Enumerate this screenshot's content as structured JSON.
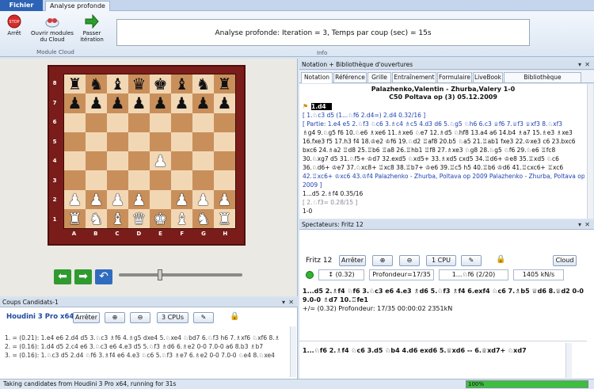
{
  "ribbon": {
    "tab_file": "Fichier",
    "tab_analysis": "Analyse profonde",
    "btn_stop": "Arrêt",
    "btn_open_cloud": "Ouvrir modules du Cloud",
    "btn_next_iter": "Passer itération",
    "group_cloud": "Module Cloud",
    "group_info": "Info",
    "info_text": "Analyse profonde: Iteration = 3, Temps par coup (sec) = 15s"
  },
  "board": {
    "ranks": [
      "8",
      "7",
      "6",
      "5",
      "4",
      "3",
      "2",
      "1"
    ],
    "files": [
      "A",
      "B",
      "C",
      "D",
      "E",
      "F",
      "G",
      "H"
    ],
    "position": [
      [
        "br",
        "bn",
        "bb",
        "bq",
        "bk",
        "bb",
        "bn",
        "br"
      ],
      [
        "bp",
        "bp",
        "bp",
        "bp",
        "bp",
        "bp",
        "bp",
        "bp"
      ],
      [
        "",
        "",
        "",
        "",
        "",
        "",
        "",
        ""
      ],
      [
        "",
        "",
        "",
        "",
        "",
        "",
        "",
        ""
      ],
      [
        "",
        "",
        "",
        "",
        "wp",
        "",
        "",
        ""
      ],
      [
        "",
        "",
        "",
        "",
        "",
        "",
        "",
        ""
      ],
      [
        "wp",
        "wp",
        "wp",
        "wp",
        "",
        "wp",
        "wp",
        "wp"
      ],
      [
        "wr",
        "wn",
        "wb",
        "wq",
        "wk",
        "wb",
        "wn",
        "wr"
      ]
    ]
  },
  "candidates": {
    "title": "Coups Candidats-1",
    "engine": "Houdini 3 Pro x64",
    "stop": "Arrêter",
    "cpus": "3 CPUs",
    "lines": [
      "1. = (0.21): 1.e4 e6 2.d4 d5 3.♘c3 ♗f6 4.♗g5 dxe4 5.♘xe4 ♘bd7 6.♘f3 h6 7.♗xf6 ♘xf6 8.♗",
      "2. = (0.16): 1.d4 d5 2.c4 e6 3.♘c3 e6 4.e3 d5 5.♘f3 ♗d6 6.♗e2 0-0 7.0-0 a6 8.b3 ♗b7",
      "3. = (0.16): 1.♘c3 d5 2.d4 ♘f6 3.♗f4 e6 4.e3 ♘c6 5.♘f3 ♗e7 6.♗e2 0-0 7.0-0 ♘e4 8.♘xe4"
    ]
  },
  "notation": {
    "title": "Notation + Bibliothèque d'ouvertures",
    "tabs": [
      "Notation",
      "Référence",
      "Grille",
      "Entraînement",
      "Formulaire",
      "LiveBook",
      "Bibliothèque d'ouvertures"
    ],
    "players": "Palazhenko,Valentin - Zhurba,Valery  1-0",
    "event": "C50 Poltava op (3) 05.12.2009",
    "lines": [
      "1.d4",
      "[ 1.♘c3  d5  (1...♘f6 2.d4=)  2.d4 0.32/16 ]",
      "[ Partie: 1.e4 e5 2.♘f3 ♘c6 3.♗c4 ♗c5 4.d3 d6 5.♘g5 ♘h6 6.c3 ♕f6 7.♕f3 ♕xf3 8.♘xf3",
      "♗g4 9.♘g5 f6 10.♘e6 ♗xe6 11.♗xe6 ♘e7 12.♗d5 ♘hf8 13.a4 a6 14.b4 ♗a7 15.♗e3 ♗xe3",
      "16.fxe3 f5 17.h3 f4 18.♔e2 ♔f6 19.♘d2 ♖af8 20.b5 ♘a5 21.♖ab1 fxe3 22.♔xe3 c6 23.bxc6",
      "bxc6 24.♗a2 ♖d8 25.♖b6 ♖a8 26.♖hb1 ♖f8 27.♗xe3 ♘g8 28.♘g5 ♘f6 29.♘e6 ♖fc8",
      "30.♘xg7 d5 31.♘f5+ ♔d7 32.exd5 ♘xd5+ 33.♗xd5 cxd5 34.♖d6+ ♔e8 35.♖xd5 ♘c6",
      "36.♘d6+ ♔e7 37.♘xc8+ ♖xc8 38.♖b7+ ♔e6 39.♖c5 h5 40.♖b6 ♔d6 41.♖cxc6+ ♖xc6",
      "42.♖xc6+ ♔xc6 43.♔f4 Palazhenko - Zhurba, Poltava op 2009 Palazhenko - Zhurba, Poltava op",
      "2009 ]",
      "1...d5  2.♗f4 0.35/16",
      "[ 2.♘f3= 0.28/15 ]",
      "1-0"
    ]
  },
  "spectators": {
    "title": "Spectateurs: Fritz 12",
    "engine": "Fritz 12",
    "stop": "Arrêter",
    "cpu": "1 CPU",
    "cloud": "Cloud",
    "eval": "(0.32)",
    "depth": "Profondeur=17/35",
    "move": "1...♘f6 (2/20)",
    "speed": "1405 kN/s",
    "line1": "1...d5 2.♗f4 ♘f6 3.♘c3 e6 4.e3 ♗d6 5.♘f3 ♗f4 6.exf4 ♘c6 7.♗b5 ♕d6 8.♕d2 0-0",
    "line2": "9.0-0 ♗d7 10.♖fe1",
    "line3": "+/=  (0.32)   Profondeur: 17/35   00:00:02   2351kN",
    "line_bottom": "1...♘f6 2.♗f4 ♘c6 3.d5 ♘b4 4.d6 exd6 5.♕xd6 -- 6.♕xd7+ ♘xd7"
  },
  "status": {
    "text": "Taking candidates from Houdini 3 Pro x64, running for 31s",
    "progress_label": "100%",
    "progress": 1.0
  }
}
